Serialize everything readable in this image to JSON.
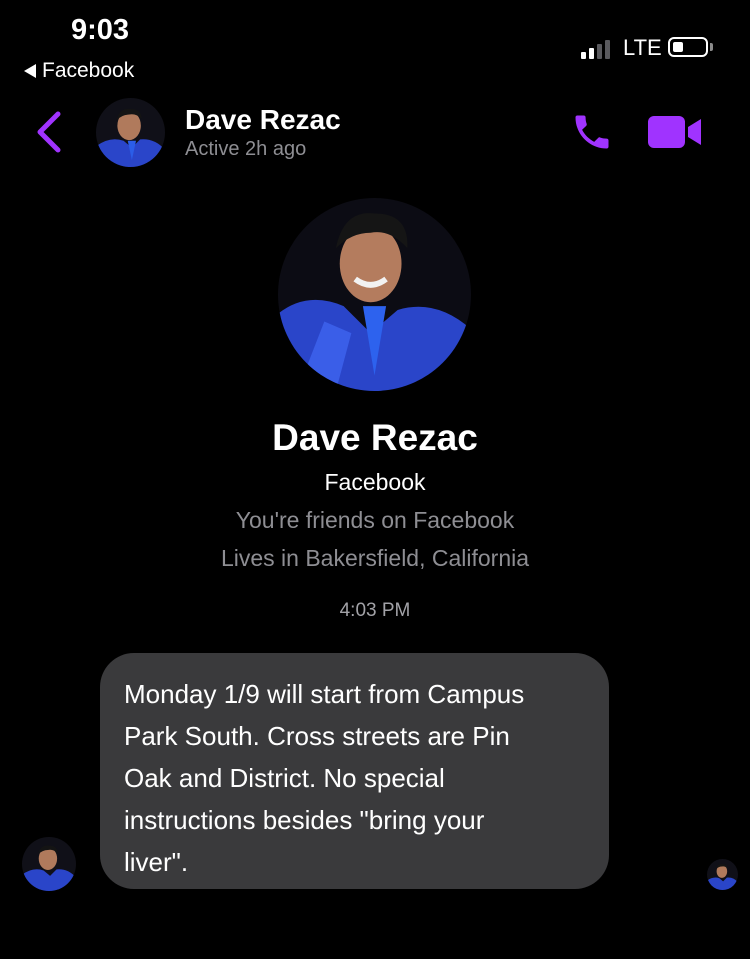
{
  "status_bar": {
    "time": "9:03",
    "back_app_label": "Facebook",
    "network": "LTE"
  },
  "header": {
    "name": "Dave Rezac",
    "status": "Active 2h ago"
  },
  "profile": {
    "name": "Dave Rezac",
    "source": "Facebook",
    "friends_note": "You're friends on Facebook",
    "location": "Lives in Bakersfield, California"
  },
  "conversation": {
    "timestamp": "4:03 PM",
    "messages": [
      {
        "text": "Monday 1/9 will start from Campus\nPark South. Cross streets are Pin\nOak and District. No special\ninstructions besides \"bring your\nliver\"."
      }
    ]
  },
  "colors": {
    "accent": "#a033ff",
    "bubble": "#3a3a3c",
    "secondary_text": "#8e8e93"
  },
  "icons": {
    "back": "chevron-left-icon",
    "call": "phone-icon",
    "video": "video-camera-icon"
  }
}
